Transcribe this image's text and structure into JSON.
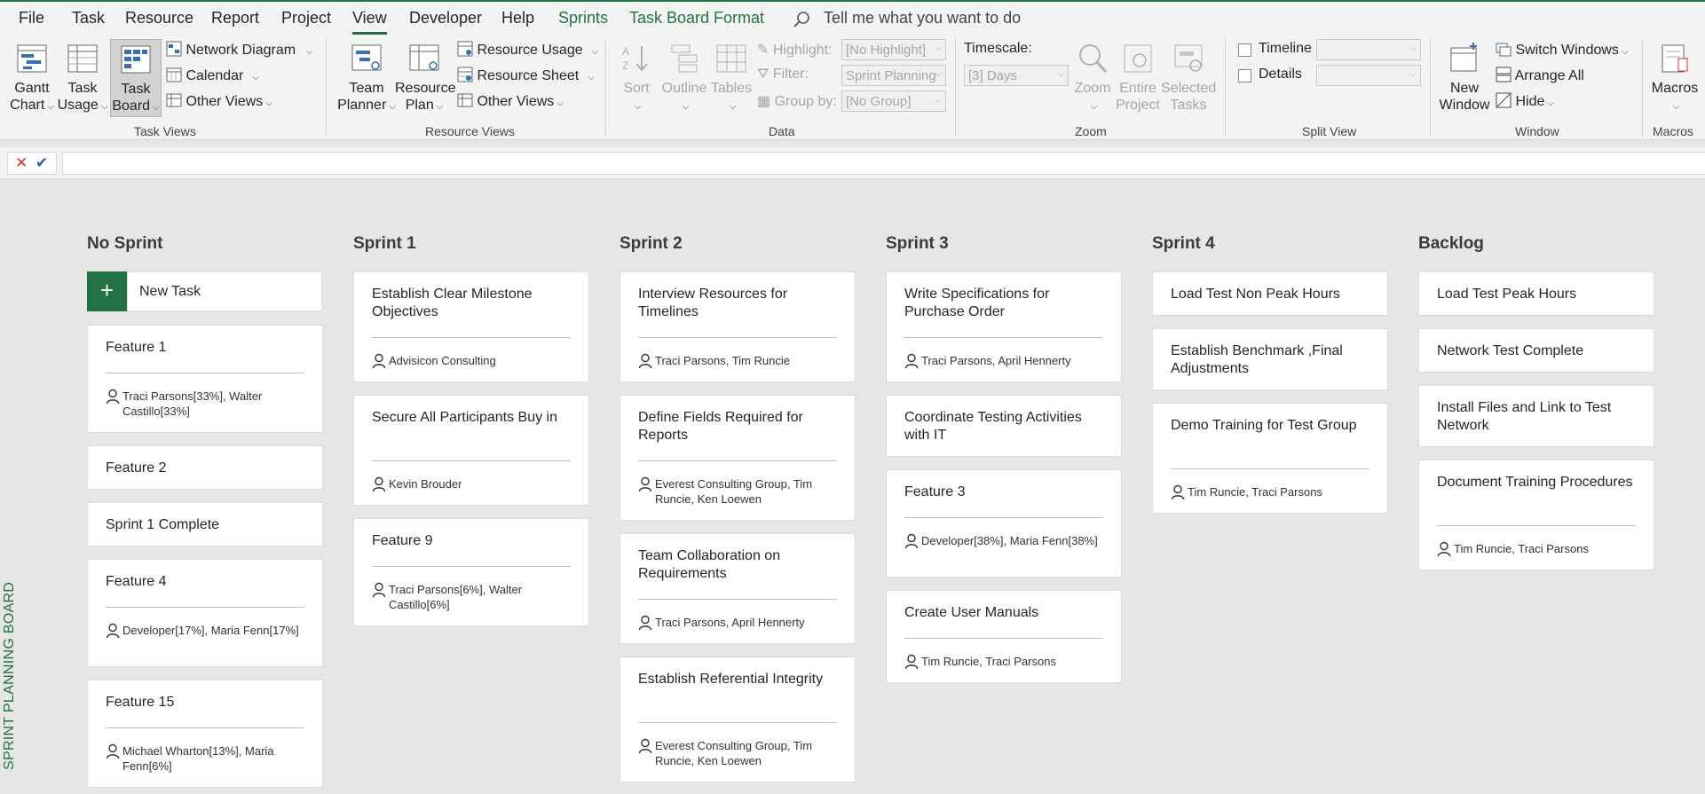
{
  "menu": {
    "tabs": [
      {
        "label": "File"
      },
      {
        "label": "Task"
      },
      {
        "label": "Resource"
      },
      {
        "label": "Report"
      },
      {
        "label": "Project"
      },
      {
        "label": "View"
      },
      {
        "label": "Developer"
      },
      {
        "label": "Help"
      },
      {
        "label": "Sprints"
      },
      {
        "label": "Task Board Format"
      }
    ],
    "active": "View",
    "tell_me": "Tell me what you want to do"
  },
  "ribbon": {
    "task_views": {
      "label": "Task Views",
      "gantt": [
        "Gantt",
        "Chart"
      ],
      "usage": [
        "Task",
        "Usage"
      ],
      "board": [
        "Task",
        "Board"
      ],
      "network": "Network Diagram",
      "calendar": "Calendar",
      "other": "Other Views"
    },
    "resource_views": {
      "label": "Resource Views",
      "team": [
        "Team",
        "Planner"
      ],
      "plan": [
        "Resource",
        "Plan"
      ],
      "usage": "Resource Usage",
      "sheet": "Resource Sheet",
      "other": "Other Views"
    },
    "data": {
      "label": "Data",
      "sort": "Sort",
      "outline": "Outline",
      "tables": "Tables",
      "highlight_label": "Highlight:",
      "highlight_value": "[No Highlight]",
      "filter_label": "Filter:",
      "filter_value": "Sprint Planning",
      "groupby_label": "Group by:",
      "groupby_value": "[No Group]"
    },
    "zoom": {
      "label": "Zoom",
      "timescale_label": "Timescale:",
      "timescale_value": "[3] Days",
      "zoom": "Zoom",
      "entire": [
        "Entire",
        "Project"
      ],
      "selected": [
        "Selected",
        "Tasks"
      ]
    },
    "split_view": {
      "label": "Split View",
      "timeline": "Timeline",
      "details": "Details"
    },
    "window": {
      "label": "Window",
      "new": [
        "New",
        "Window"
      ],
      "switch": "Switch Windows",
      "arrange": "Arrange All",
      "hide": "Hide"
    },
    "macros": {
      "label": "Macros",
      "macros": "Macros"
    }
  },
  "board": {
    "side_label": "SPRINT PLANNING BOARD",
    "new_task": "New Task",
    "columns": [
      {
        "title": "No Sprint",
        "cards": [
          {
            "title": "Feature 1",
            "res": "Traci Parsons[33%], Walter Castillo[33%]"
          },
          {
            "title": "Feature 2"
          },
          {
            "title": "Sprint 1 Complete"
          },
          {
            "title": "Feature 4",
            "res": "Developer[17%], Maria Fenn[17%]"
          },
          {
            "title": "Feature 15",
            "res": "Michael Wharton[13%], Maria Fenn[6%]"
          }
        ]
      },
      {
        "title": "Sprint 1",
        "cards": [
          {
            "title": "Establish Clear Milestone Objectives",
            "res": "Advisicon Consulting"
          },
          {
            "title": "Secure All Participants Buy in",
            "res": "Kevin Brouder"
          },
          {
            "title": "Feature 9",
            "res": "Traci Parsons[6%], Walter Castillo[6%]"
          }
        ]
      },
      {
        "title": "Sprint 2",
        "cards": [
          {
            "title": "Interview Resources for Timelines",
            "res": "Traci Parsons, Tim Runcie"
          },
          {
            "title": "Define Fields Required for Reports",
            "res": "Everest Consulting Group, Tim Runcie, Ken Loewen"
          },
          {
            "title": "Team Collaboration on Requirements",
            "res": "Traci Parsons, April Hennerty"
          },
          {
            "title": "Establish Referential Integrity",
            "res": "Everest Consulting Group, Tim Runcie, Ken Loewen"
          }
        ]
      },
      {
        "title": "Sprint 3",
        "cards": [
          {
            "title": "Write Specifications for Purchase Order",
            "res": "Traci Parsons, April Hennerty"
          },
          {
            "title": "Coordinate Testing Activities with IT"
          },
          {
            "title": "Feature 3",
            "res": "Developer[38%], Maria Fenn[38%]"
          },
          {
            "title": "Create User Manuals",
            "res": "Tim Runcie, Traci Parsons"
          }
        ]
      },
      {
        "title": "Sprint 4",
        "cards": [
          {
            "title": "Load Test Non Peak Hours"
          },
          {
            "title": "Establish Benchmark ,Final Adjustments"
          },
          {
            "title": "Demo Training for Test Group",
            "res": "Tim Runcie, Traci Parsons"
          }
        ]
      },
      {
        "title": "Backlog",
        "cards": [
          {
            "title": "Load Test Peak Hours"
          },
          {
            "title": "Network Test Complete"
          },
          {
            "title": "Install Files and Link to Test Network"
          },
          {
            "title": "Document Training Procedures",
            "res": "Tim Runcie, Traci Parsons"
          }
        ]
      }
    ]
  }
}
